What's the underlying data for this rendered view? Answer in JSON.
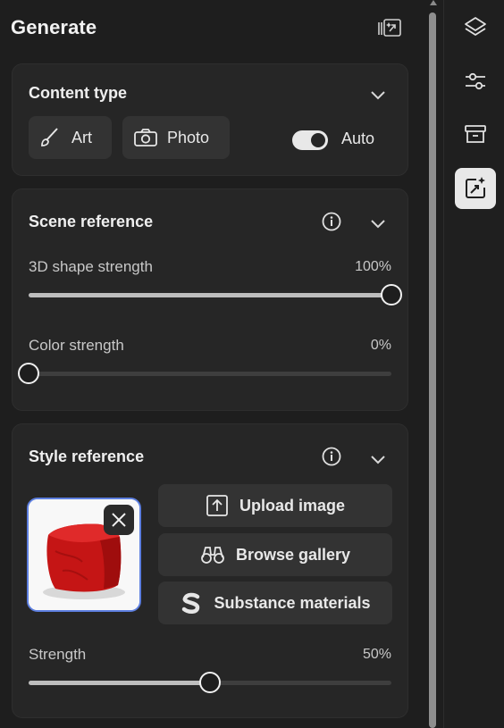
{
  "panel": {
    "title": "Generate",
    "header_icon": "panel-expand-icon"
  },
  "content_type": {
    "title": "Content type",
    "art_label": "Art",
    "photo_label": "Photo",
    "auto_label": "Auto",
    "auto_enabled": true
  },
  "scene_reference": {
    "title": "Scene reference",
    "shape_label": "3D shape strength",
    "shape_value_text": "100%",
    "shape_value": 1.0,
    "color_label": "Color strength",
    "color_value_text": "0%",
    "color_value": 0.0
  },
  "style_reference": {
    "title": "Style reference",
    "image_subject": "red cube cushion",
    "upload_label": "Upload image",
    "browse_label": "Browse gallery",
    "substance_label": "Substance materials",
    "strength_label": "Strength",
    "strength_value_text": "50%",
    "strength_value": 0.5
  },
  "rail": {
    "items": [
      "layers-icon",
      "adjustments-icon",
      "archive-icon",
      "generate-image-icon"
    ],
    "active": "generate-image-icon"
  },
  "colors": {
    "background": "#1e1e1e",
    "card": "#262626",
    "button": "#333333",
    "selection_border": "#5d7fe0",
    "cube_red": "#d41a1a"
  }
}
